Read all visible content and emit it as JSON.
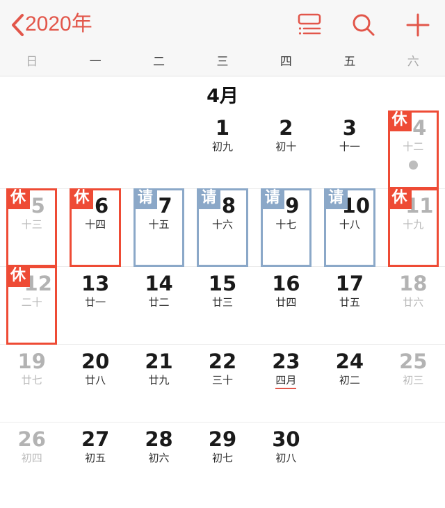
{
  "navbar": {
    "back_icon": "chevron-left-icon",
    "title": "2020年",
    "accent_color": "#e2564a",
    "actions": [
      {
        "name": "list-view-button",
        "icon": "list-view-icon"
      },
      {
        "name": "search-button",
        "icon": "search-icon"
      },
      {
        "name": "add-event-button",
        "icon": "plus-icon"
      }
    ]
  },
  "weekdays": [
    {
      "label": "日",
      "weekend": true
    },
    {
      "label": "一",
      "weekend": false
    },
    {
      "label": "二",
      "weekend": false
    },
    {
      "label": "三",
      "weekend": false
    },
    {
      "label": "四",
      "weekend": false
    },
    {
      "label": "五",
      "weekend": false
    },
    {
      "label": "六",
      "weekend": true
    }
  ],
  "month": {
    "title": "4月"
  },
  "legend": {
    "rest_label": "休",
    "work_label": "请",
    "rest_color": "#ee4b35",
    "work_color": "#8ba8c8"
  },
  "weeks": [
    [
      {
        "day": "",
        "lunar": "",
        "empty": true
      },
      {
        "day": "",
        "lunar": "",
        "empty": true
      },
      {
        "day": "",
        "lunar": "",
        "empty": true
      },
      {
        "day": "1",
        "lunar": "初九"
      },
      {
        "day": "2",
        "lunar": "初十"
      },
      {
        "day": "3",
        "lunar": "十一"
      },
      {
        "day": "4",
        "lunar": "十二",
        "mark": "rest",
        "badge": "休",
        "weekend": true,
        "dot": true
      }
    ],
    [
      {
        "day": "5",
        "lunar": "十三",
        "mark": "rest",
        "badge": "休",
        "weekend": true
      },
      {
        "day": "6",
        "lunar": "十四",
        "mark": "rest",
        "badge": "休"
      },
      {
        "day": "7",
        "lunar": "十五",
        "mark": "work",
        "badge": "请"
      },
      {
        "day": "8",
        "lunar": "十六",
        "mark": "work",
        "badge": "请"
      },
      {
        "day": "9",
        "lunar": "十七",
        "mark": "work",
        "badge": "请"
      },
      {
        "day": "10",
        "lunar": "十八",
        "mark": "work",
        "badge": "请"
      },
      {
        "day": "11",
        "lunar": "十九",
        "mark": "rest",
        "badge": "休",
        "weekend": true
      }
    ],
    [
      {
        "day": "12",
        "lunar": "二十",
        "mark": "rest",
        "badge": "休",
        "weekend": true
      },
      {
        "day": "13",
        "lunar": "廿一"
      },
      {
        "day": "14",
        "lunar": "廿二"
      },
      {
        "day": "15",
        "lunar": "廿三"
      },
      {
        "day": "16",
        "lunar": "廿四"
      },
      {
        "day": "17",
        "lunar": "廿五"
      },
      {
        "day": "18",
        "lunar": "廿六",
        "weekend": true
      }
    ],
    [
      {
        "day": "19",
        "lunar": "廿七",
        "weekend": true
      },
      {
        "day": "20",
        "lunar": "廿八"
      },
      {
        "day": "21",
        "lunar": "廿九"
      },
      {
        "day": "22",
        "lunar": "三十"
      },
      {
        "day": "23",
        "lunar": "四月",
        "festival": true
      },
      {
        "day": "24",
        "lunar": "初二"
      },
      {
        "day": "25",
        "lunar": "初三",
        "weekend": true
      }
    ],
    [
      {
        "day": "26",
        "lunar": "初四",
        "weekend": true
      },
      {
        "day": "27",
        "lunar": "初五"
      },
      {
        "day": "28",
        "lunar": "初六"
      },
      {
        "day": "29",
        "lunar": "初七"
      },
      {
        "day": "30",
        "lunar": "初八"
      },
      {
        "day": "",
        "lunar": "",
        "empty": true
      },
      {
        "day": "",
        "lunar": "",
        "empty": true
      }
    ]
  ]
}
